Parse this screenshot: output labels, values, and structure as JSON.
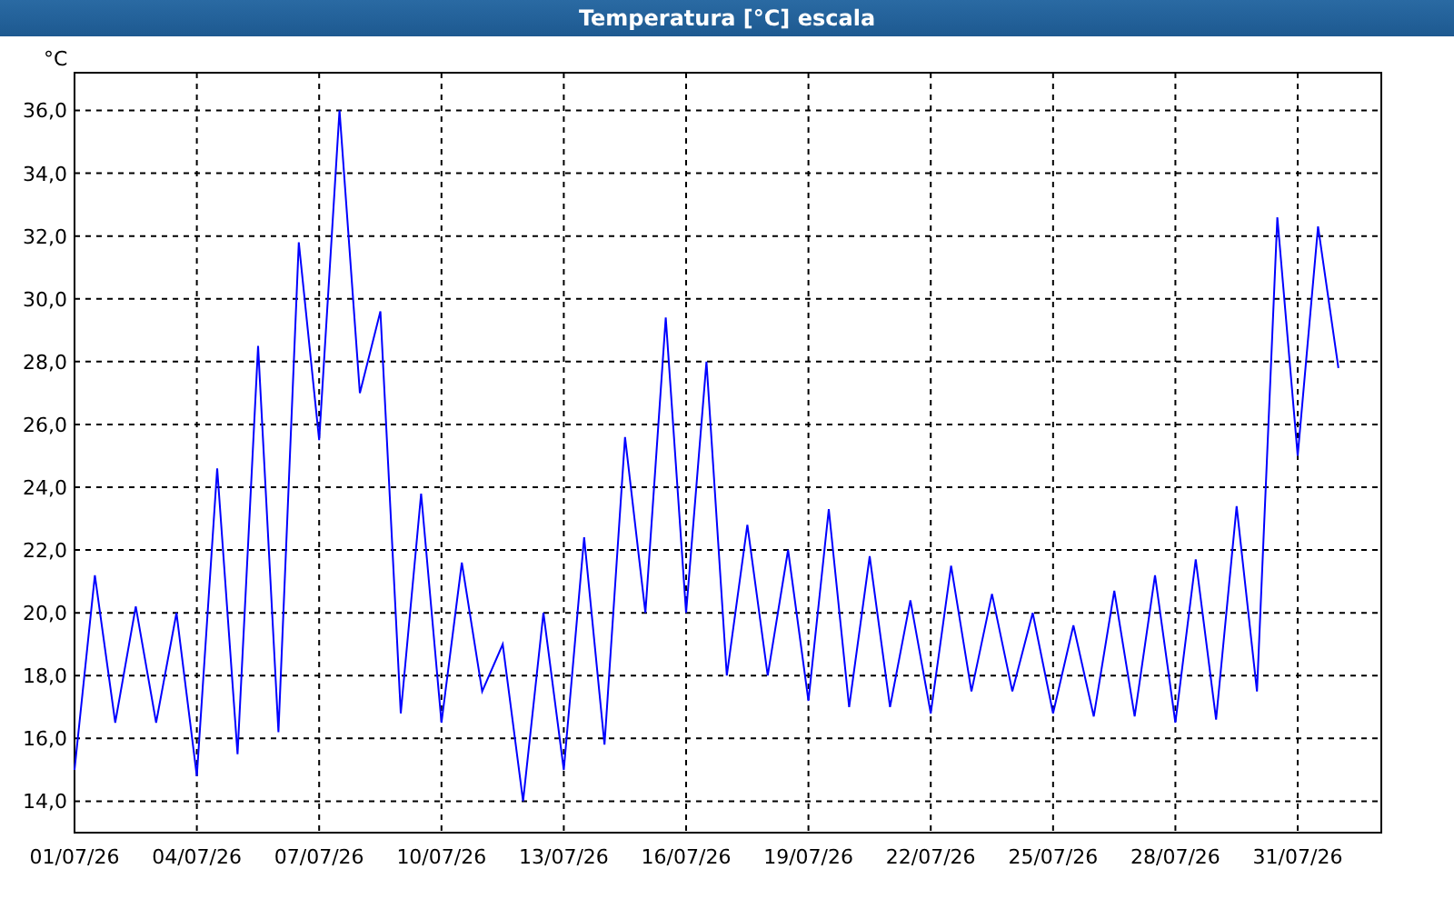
{
  "window": {
    "title": "Temperatura [°C] escala"
  },
  "chart": {
    "chart_data": {
      "type": "line",
      "ylabel": "°C",
      "categories": [
        "01/07/26",
        null,
        null,
        null,
        null,
        null,
        "04/07/26",
        null,
        null,
        null,
        null,
        null,
        "07/07/26",
        null,
        null,
        null,
        null,
        null,
        "10/07/26",
        null,
        null,
        null,
        null,
        null,
        "13/07/26",
        null,
        null,
        null,
        null,
        null,
        "16/07/26",
        null,
        null,
        null,
        null,
        null,
        "19/07/26",
        null,
        null,
        null,
        null,
        null,
        "22/07/26",
        null,
        null,
        null,
        null,
        null,
        "25/07/26",
        null,
        null,
        null,
        null,
        null,
        "28/07/26",
        null,
        null,
        null,
        null,
        null,
        "31/07/26",
        null,
        null
      ],
      "series": [
        {
          "color": "#0000ff",
          "values": [
            15.0,
            21.2,
            16.5,
            20.2,
            16.5,
            20.0,
            14.8,
            24.6,
            15.5,
            28.5,
            16.2,
            31.8,
            25.5,
            36.0,
            27.0,
            29.6,
            16.8,
            23.8,
            16.5,
            21.6,
            17.5,
            19.0,
            14.0,
            20.0,
            15.0,
            22.4,
            15.8,
            25.6,
            20.0,
            29.4,
            20.0,
            28.0,
            18.0,
            22.8,
            18.0,
            22.0,
            17.2,
            23.3,
            17.0,
            21.8,
            17.0,
            20.4,
            16.8,
            21.5,
            17.5,
            20.6,
            17.5,
            20.0,
            16.8,
            19.6,
            16.7,
            20.7,
            16.7,
            21.2,
            16.5,
            21.7,
            16.6,
            23.4,
            17.5,
            32.6,
            25.0,
            32.3,
            27.8
          ]
        }
      ],
      "grid": true,
      "ylim": [
        13,
        37.2
      ],
      "yticks": [
        {
          "value": 14,
          "label": "14,0"
        },
        {
          "value": 16,
          "label": "16,0"
        },
        {
          "value": 18,
          "label": "18,0"
        },
        {
          "value": 20,
          "label": "20,0"
        },
        {
          "value": 22,
          "label": "22,0"
        },
        {
          "value": 24,
          "label": "24,0"
        },
        {
          "value": 26,
          "label": "26,0"
        },
        {
          "value": 28,
          "label": "28,0"
        },
        {
          "value": 30,
          "label": "30,0"
        },
        {
          "value": 32,
          "label": "32,0"
        },
        {
          "value": 34,
          "label": "34,0"
        },
        {
          "value": 36,
          "label": "36,0"
        }
      ]
    }
  }
}
